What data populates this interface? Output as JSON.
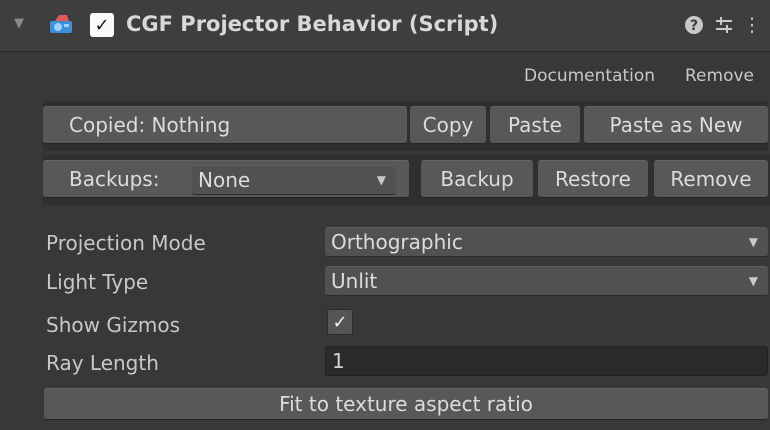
{
  "header": {
    "foldout_icon": "triangle-down-icon",
    "component_icon": "projector-icon",
    "enabled": true,
    "enabled_glyph": "✓",
    "title": "CGF Projector Behavior (Script)",
    "help_glyph": "?",
    "presets_glyph": "⇅",
    "menu_glyph": "⋮"
  },
  "links": {
    "documentation": "Documentation",
    "remove": "Remove"
  },
  "clipboard": {
    "copied_text": "Copied: Nothing",
    "copy": "Copy",
    "paste": "Paste",
    "paste_as_new": "Paste as New"
  },
  "backups": {
    "label": "Backups:",
    "selected": "None",
    "backup": "Backup",
    "restore": "Restore",
    "remove": "Remove"
  },
  "properties": {
    "projection_mode_label": "Projection Mode",
    "projection_mode_value": "Orthographic",
    "light_type_label": "Light Type",
    "light_type_value": "Unlit",
    "show_gizmos_label": "Show Gizmos",
    "show_gizmos_checked": true,
    "show_gizmos_glyph": "✓",
    "ray_length_label": "Ray Length",
    "ray_length_value": "1"
  },
  "actions": {
    "fit_texture": "Fit to texture aspect ratio"
  },
  "dropdown_caret": "▼",
  "colors": {
    "background": "#383838",
    "header": "#3e3e3e",
    "button": "#585858",
    "icon_blue": "#4aa3e6",
    "icon_red": "#e05a5a"
  }
}
